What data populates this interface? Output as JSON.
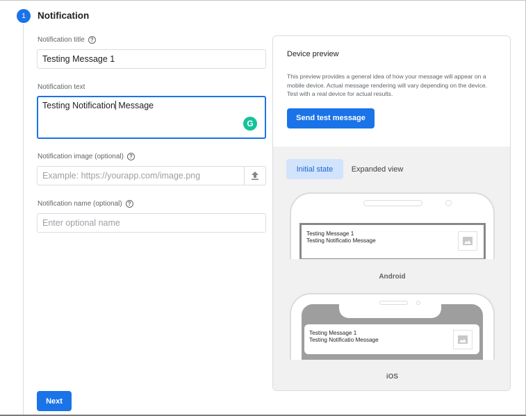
{
  "step": {
    "number": "1",
    "title": "Notification"
  },
  "fields": {
    "title_label": "Notification title",
    "title_value": "Testing Message 1",
    "text_label": "Notification text",
    "text_value_before": "Testing Notification",
    "text_value_after": " Message",
    "image_label": "Notification image (optional)",
    "image_placeholder": "Example: https://yourapp.com/image.png",
    "name_label": "Notification name (optional)",
    "name_placeholder": "Enter optional name",
    "help_glyph": "?",
    "grammarly_glyph": "G"
  },
  "next_label": "Next",
  "preview": {
    "title": "Device preview",
    "description": "This preview provides a general idea of how your message will appear on a mobile device. Actual message rendering will vary depending on the device. Test with a real device for actual results.",
    "send_label": "Send test message",
    "tabs": [
      {
        "label": "Initial state",
        "active": true
      },
      {
        "label": "Expanded view",
        "active": false
      }
    ],
    "android": {
      "label": "Android",
      "notif_title": "Testing Message 1",
      "notif_text": "Testing Notificatio Message"
    },
    "ios": {
      "label": "iOS",
      "notif_title": "Testing Message 1",
      "notif_text": "Testing Notificatio Message"
    }
  },
  "colors": {
    "primary": "#1a73e8",
    "grammarly": "#15c39a",
    "tab_active_bg": "#d2e3fc"
  },
  "icons": [
    "help-icon",
    "upload-icon",
    "grammarly-icon",
    "image-placeholder-icon"
  ]
}
